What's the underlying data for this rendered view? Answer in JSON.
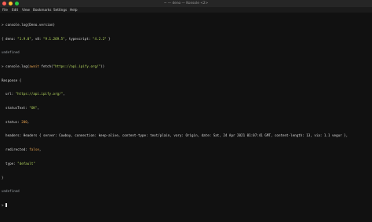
{
  "window": {
    "title": "~ — deno — Konsole <2>"
  },
  "menu": {
    "items": [
      "File",
      "Edit",
      "View",
      "Bookmarks",
      "Settings",
      "Help"
    ]
  },
  "terminal": {
    "l1": {
      "prompt": "> ",
      "text": "console.log(Deno.version)"
    },
    "l2": {
      "a": "{ deno: ",
      "b": "\"1.9.0\"",
      "c": ", v8: ",
      "d": "\"9.1.269.5\"",
      "e": ", typescript: ",
      "f": "\"4.2.2\"",
      "g": " }"
    },
    "l3": {
      "text": "undefined"
    },
    "l4": {
      "prompt": "> ",
      "a": "console.log(",
      "b": "await",
      "c": " fetch(",
      "d": "\"https://api.ipify.org/\"",
      "e": "))"
    },
    "l5": {
      "text": "Response {"
    },
    "l6": {
      "a": "  url: ",
      "b": "\"https://api.ipify.org/\"",
      "c": ","
    },
    "l7": {
      "a": "  statusText: ",
      "b": "\"OK\"",
      "c": ","
    },
    "l8": {
      "a": "  status: ",
      "b": "200",
      "c": ","
    },
    "l9": {
      "text": "  headers: Headers { server: Cowboy, connection: keep-alive, content-type: text/plain, vary: Origin, date: Sat, 24 Apr 2021 01:07:41 GMT, content-length: 13, via: 1.1 vegur },"
    },
    "l10": {
      "a": "  redirected: ",
      "b": "false",
      "c": ","
    },
    "l11": {
      "a": "  type: ",
      "b": "\"default\""
    },
    "l12": {
      "text": "}"
    },
    "l13": {
      "text": "undefined"
    },
    "l14": {
      "prompt": "> "
    }
  },
  "colors": {
    "string": "#b6d95f",
    "number": "#e8a24d",
    "close": "#ff5f57",
    "minimize": "#febc2e",
    "maximize": "#28c840"
  }
}
